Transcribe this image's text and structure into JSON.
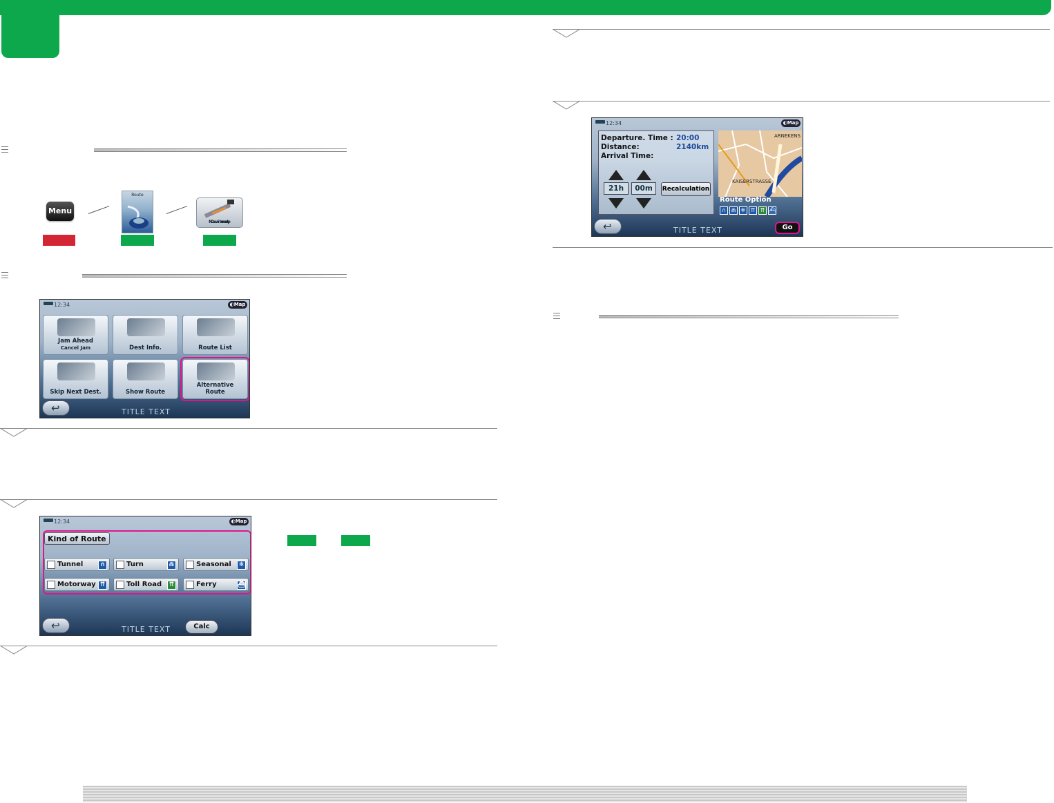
{
  "colors": {
    "brand_green": "#0ea84c",
    "red": "#d42535",
    "highlight": "#e0158e"
  },
  "path": {
    "menu_label": "Menu",
    "route_label": "Route",
    "navi_label_1": "Navi map",
    "navi_label_2": "Context"
  },
  "menu_screen": {
    "time": "12:34",
    "map_label": "Map",
    "tiles": [
      {
        "label": "Jam Ahead",
        "sub": "Cancel Jam"
      },
      {
        "label": "Dest Info.",
        "sub": ""
      },
      {
        "label": "Route List",
        "sub": ""
      },
      {
        "label": "Skip Next Dest.",
        "sub": ""
      },
      {
        "label": "Show Route",
        "sub": ""
      },
      {
        "label": "Alternative",
        "sub": "Route"
      }
    ],
    "title": "TITLE TEXT"
  },
  "kind_screen": {
    "time": "12:34",
    "map_label": "Map",
    "heading": "Kind of Route",
    "options": [
      {
        "label": "Tunnel",
        "icon": "∩"
      },
      {
        "label": "Turn",
        "icon": "⋒"
      },
      {
        "label": "Seasonal",
        "icon": "❄"
      },
      {
        "label": "Motorway",
        "icon": "⇈"
      },
      {
        "label": "Toll Road",
        "icon": "⇈"
      },
      {
        "label": "Ferry",
        "icon": "⛴"
      }
    ],
    "title": "TITLE TEXT",
    "calc_label": "Calc"
  },
  "depart_screen": {
    "time": "12:34",
    "map_label": "Map",
    "departure_label": "Departure. Time :",
    "departure_value": "20:00",
    "distance_label": "Distance:",
    "distance_value": "2140km",
    "arrival_label": "Arrival Time:",
    "hours": "21h",
    "minutes": "00m",
    "recalc_label": "Recalculation",
    "map_place_1": "ARNEKENS",
    "map_place_2": "KAISERSTRASSE",
    "route_option_label": "Route Option",
    "title": "TITLE TEXT",
    "go_label": "Go"
  }
}
